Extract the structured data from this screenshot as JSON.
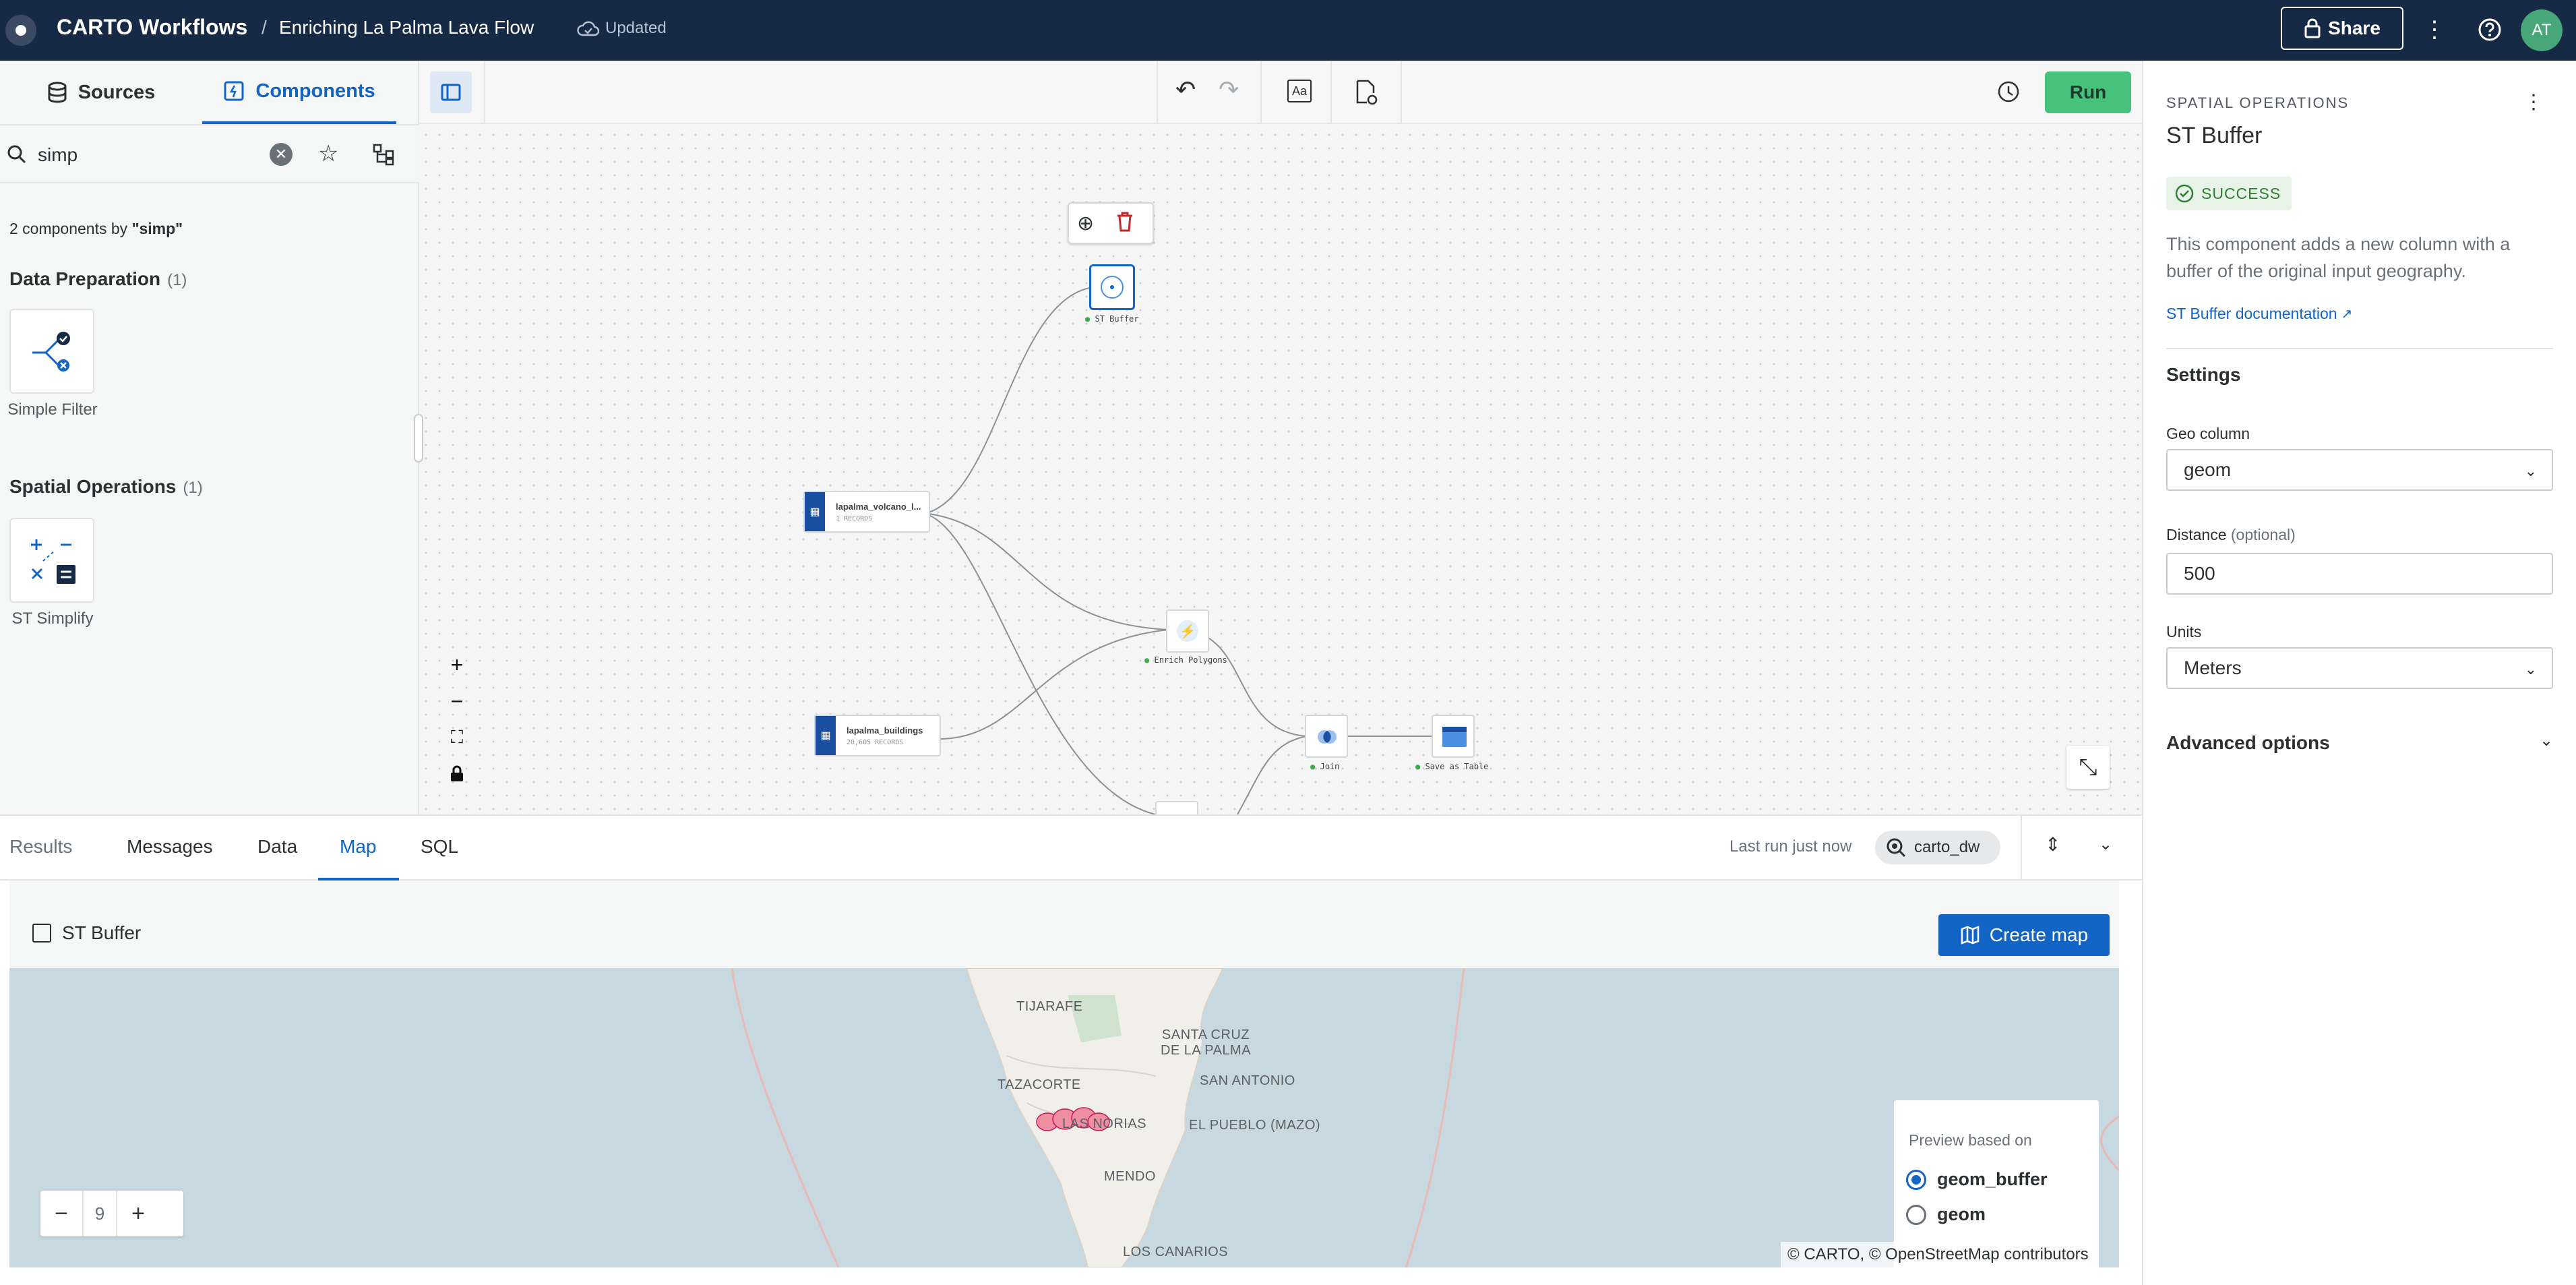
{
  "topbar": {
    "app": "CARTO Workflows",
    "sep": "/",
    "title": "Enriching La Palma Lava Flow",
    "status": "Updated",
    "share": "Share",
    "avatar": "AT"
  },
  "left": {
    "tabs": [
      {
        "label": "Sources"
      },
      {
        "label": "Components"
      }
    ],
    "search_value": "simp",
    "result_count_prefix": "2 components by ",
    "result_count_term": "\"simp\"",
    "sections": [
      {
        "title": "Data Preparation",
        "count": "(1)",
        "item": "Simple Filter"
      },
      {
        "title": "Spatial Operations",
        "count": "(1)",
        "item": "ST Simplify"
      }
    ]
  },
  "canvas": {
    "run": "Run",
    "nodes": {
      "st_buffer": "ST Buffer",
      "volcano": "lapalma_volcano_l...",
      "volcano_sub": "1 RECORDS",
      "buildings": "lapalma_buildings",
      "buildings_sub": "20,605 RECORDS",
      "enrich": "Enrich Polygons",
      "join": "Join",
      "save": "Save as Table"
    }
  },
  "bottom": {
    "tabs": [
      "Results",
      "Messages",
      "Data",
      "Map",
      "SQL"
    ],
    "active_tab": "Map",
    "last_run": "Last run just now",
    "connection": "carto_dw",
    "panel_title": "ST Buffer",
    "create_map": "Create map",
    "zoom": "9",
    "map_labels": [
      "TIJARAFE",
      "SANTA CRUZ DE LA PALMA",
      "TAZACORTE",
      "SAN ANTONIO",
      "LAS NORIAS",
      "EL PUEBLO (MAZO)",
      "MENDO",
      "LOS CANARIOS"
    ],
    "preview_title": "Preview based on",
    "preview_options": [
      "geom_buffer",
      "geom"
    ],
    "attribution": "© CARTO, © OpenStreetMap contributors"
  },
  "right": {
    "category": "SPATIAL OPERATIONS",
    "title": "ST Buffer",
    "status": "SUCCESS",
    "description": "This component adds a new column with a buffer of the original input geography.",
    "doc_link": "ST Buffer documentation",
    "settings": "Settings",
    "geo_column_label": "Geo column",
    "geo_column_value": "geom",
    "distance_label": "Distance",
    "distance_optional": "(optional)",
    "distance_value": "500",
    "units_label": "Units",
    "units_value": "Meters",
    "advanced": "Advanced options"
  },
  "colors": {
    "topbar": "#162945",
    "accent": "#1264c5",
    "run": "#47c27c",
    "success": "#2e7d32"
  }
}
